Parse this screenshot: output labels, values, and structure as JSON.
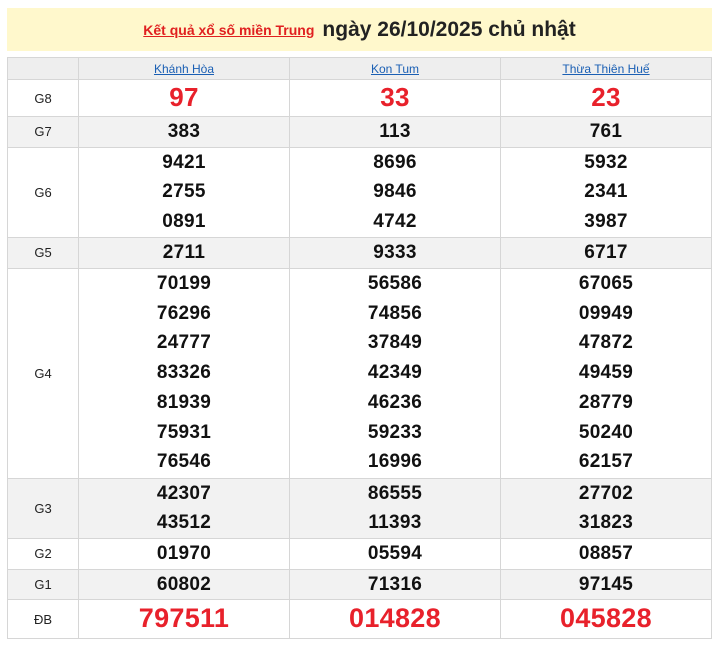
{
  "header": {
    "link_text": "Kết quả xổ số miền Trung",
    "date_text": "ngày 26/10/2025 chủ nhật"
  },
  "provinces": [
    "Khánh Hòa",
    "Kon Tum",
    "Thừa Thiên Huế"
  ],
  "prizes": [
    {
      "label": "G8",
      "values": [
        [
          "97"
        ],
        [
          "33"
        ],
        [
          "23"
        ]
      ]
    },
    {
      "label": "G7",
      "values": [
        [
          "383"
        ],
        [
          "113"
        ],
        [
          "761"
        ]
      ]
    },
    {
      "label": "G6",
      "values": [
        [
          "9421",
          "2755",
          "0891"
        ],
        [
          "8696",
          "9846",
          "4742"
        ],
        [
          "5932",
          "2341",
          "3987"
        ]
      ]
    },
    {
      "label": "G5",
      "values": [
        [
          "2711"
        ],
        [
          "9333"
        ],
        [
          "6717"
        ]
      ]
    },
    {
      "label": "G4",
      "values": [
        [
          "70199",
          "76296",
          "24777",
          "83326",
          "81939",
          "75931",
          "76546"
        ],
        [
          "56586",
          "74856",
          "37849",
          "42349",
          "46236",
          "59233",
          "16996"
        ],
        [
          "67065",
          "09949",
          "47872",
          "49459",
          "28779",
          "50240",
          "62157"
        ]
      ]
    },
    {
      "label": "G3",
      "values": [
        [
          "42307",
          "43512"
        ],
        [
          "86555",
          "11393"
        ],
        [
          "27702",
          "31823"
        ]
      ]
    },
    {
      "label": "G2",
      "values": [
        [
          "01970"
        ],
        [
          "05594"
        ],
        [
          "08857"
        ]
      ]
    },
    {
      "label": "G1",
      "values": [
        [
          "60802"
        ],
        [
          "71316"
        ],
        [
          "97145"
        ]
      ]
    },
    {
      "label": "ĐB",
      "values": [
        [
          "797511"
        ],
        [
          "014828"
        ],
        [
          "045828"
        ]
      ]
    }
  ],
  "colors": {
    "header_bg": "#fff8cc",
    "accent_red": "#e8212b",
    "link_blue": "#1a5fb4",
    "alt_row": "#f2f2f2"
  }
}
